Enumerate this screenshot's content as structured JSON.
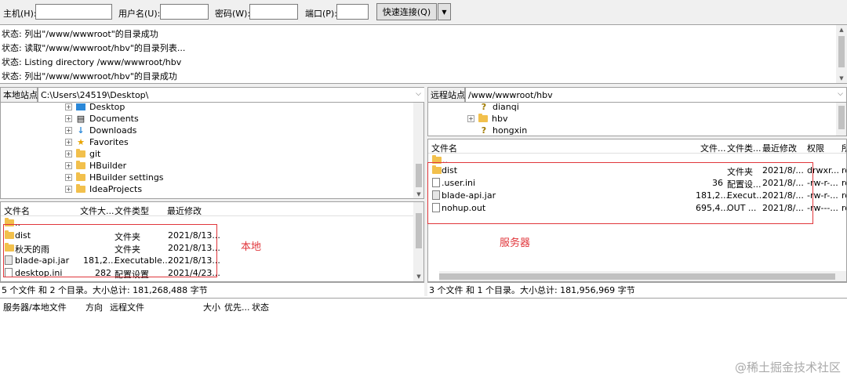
{
  "quickconnect": {
    "host_label": "主机(H):",
    "user_label": "用户名(U):",
    "password_label": "密码(W):",
    "port_label": "端口(P):",
    "connect_button": "快速连接(Q)",
    "host_value": "",
    "user_value": "",
    "password_value": "",
    "port_value": ""
  },
  "log": [
    "状态:  列出\"/www/wwwroot\"的目录成功",
    "状态:  读取\"/www/wwwroot/hbv\"的目录列表...",
    "状态:  Listing directory /www/wwwroot/hbv",
    "状态:  列出\"/www/wwwroot/hbv\"的目录成功"
  ],
  "local": {
    "site_label": "本地站点:",
    "path": "C:\\Users\\24519\\Desktop\\",
    "tree": [
      "Desktop",
      "Documents",
      "Downloads",
      "Favorites",
      "git",
      "HBuilder",
      "HBuilder settings",
      "IdeaProjects"
    ],
    "columns": [
      "文件名",
      "文件大...",
      "文件类型",
      "最近修改"
    ],
    "parent_row": "..",
    "files": [
      {
        "name": "dist",
        "size": "",
        "type": "文件夹",
        "modified": "2021/8/13..."
      },
      {
        "name": "秋天的雨",
        "size": "",
        "type": "文件夹",
        "modified": "2021/8/13..."
      },
      {
        "name": "blade-api.jar",
        "size": "181,2...",
        "type": "Executable...",
        "modified": "2021/8/13..."
      },
      {
        "name": "desktop.ini",
        "size": "282",
        "type": "配置设置",
        "modified": "2021/4/23..."
      }
    ],
    "annotation": "本地",
    "status": "5 个文件 和 2 个目录。大小总计: 181,268,488 字节"
  },
  "remote": {
    "site_label": "远程站点:",
    "path": "/www/wwwroot/hbv",
    "tree": [
      "dianqi",
      "hbv",
      "hongxin"
    ],
    "columns": [
      "文件名",
      "文件...",
      "文件类...",
      "最近修改",
      "权限",
      "所"
    ],
    "parent_row": "..",
    "files": [
      {
        "name": "dist",
        "size": "",
        "type": "文件夹",
        "modified": "2021/8/...",
        "perm": "drwxr...",
        "owner": "ro"
      },
      {
        "name": ".user.ini",
        "size": "36",
        "type": "配置设...",
        "modified": "2021/8/...",
        "perm": "-rw-r-...",
        "owner": "ro"
      },
      {
        "name": "blade-api.jar",
        "size": "181,2...",
        "type": "Execut...",
        "modified": "2021/8/...",
        "perm": "-rw-r-...",
        "owner": "ro"
      },
      {
        "name": "nohup.out",
        "size": "695,4...",
        "type": "OUT ...",
        "modified": "2021/8/...",
        "perm": "-rw---...",
        "owner": "ro"
      }
    ],
    "annotation": "服务器",
    "status": "3 个文件 和 1 个目录。大小总计: 181,956,969 字节"
  },
  "queue": {
    "columns": [
      "服务器/本地文件",
      "方向",
      "远程文件",
      "大小",
      "优先...",
      "状态"
    ]
  },
  "watermark": "@稀土掘金技术社区"
}
